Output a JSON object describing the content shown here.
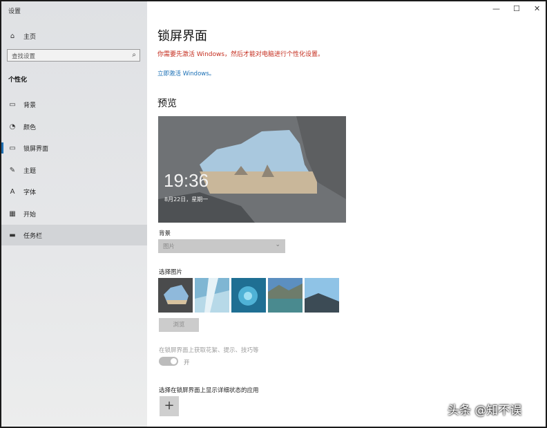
{
  "window": {
    "title": "设置",
    "minimize": "—",
    "maximize": "☐",
    "close": "✕"
  },
  "sidebar": {
    "home": {
      "icon": "home-icon",
      "glyph": "⌂",
      "label": "主页"
    },
    "search_placeholder": "查找设置",
    "section_title": "个性化",
    "items": [
      {
        "icon": "image-icon",
        "glyph": "▭",
        "label": "背景"
      },
      {
        "icon": "palette-icon",
        "glyph": "◔",
        "label": "颜色"
      },
      {
        "icon": "lockscreen-icon",
        "glyph": "▭",
        "label": "锁屏界面"
      },
      {
        "icon": "brush-icon",
        "glyph": "✎",
        "label": "主题"
      },
      {
        "icon": "font-icon",
        "glyph": "A",
        "label": "字体"
      },
      {
        "icon": "start-icon",
        "glyph": "▦",
        "label": "开始"
      },
      {
        "icon": "taskbar-icon",
        "glyph": "▬",
        "label": "任务栏"
      }
    ]
  },
  "main": {
    "title": "锁屏界面",
    "warning": "你需要先激活 Windows，然后才能对电脑进行个性化设置。",
    "activate_link": "立即激活 Windows。",
    "preview_heading": "预览",
    "preview": {
      "time": "19:36",
      "date": "8月22日，星期一"
    },
    "background_label": "背景",
    "background_value": "图片",
    "choose_picture_label": "选择图片",
    "browse_button": "浏览",
    "fun_facts_label": "在锁屏界面上获取花絮、提示、技巧等",
    "toggle_state": "开",
    "detailed_status_label": "选择在锁屏界面上显示详细状态的应用",
    "add_app_button": "+"
  },
  "watermark": "头条 @知不误",
  "colors": {
    "accent": "#1f6fb2",
    "warning": "#c42b1c",
    "link": "#1a6fb5"
  }
}
